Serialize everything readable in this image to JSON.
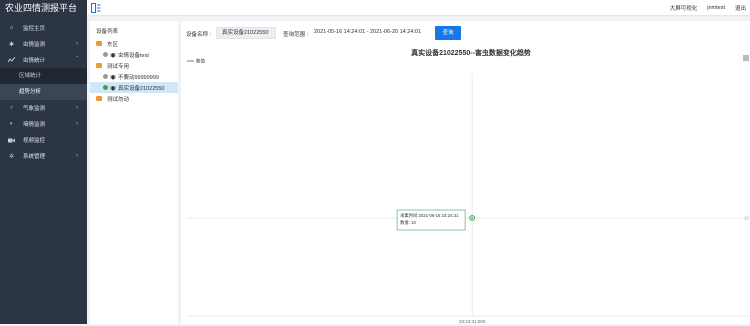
{
  "app": {
    "title": "农业四情测报平台"
  },
  "topnav": {
    "bigscreen": "大屏可视化",
    "user": "jnmtest",
    "logout": "退出"
  },
  "sidebar": {
    "items": [
      {
        "label": "监控主页",
        "icon": "home-icon",
        "expandable": false
      },
      {
        "label": "虫情监测",
        "icon": "bug-icon",
        "expandable": true
      },
      {
        "label": "虫情统计",
        "icon": "chart-icon",
        "expandable": true,
        "open": true
      }
    ],
    "subitems": [
      {
        "label": "区域统计",
        "active": false
      },
      {
        "label": "趋势分析",
        "active": true
      }
    ],
    "items2": [
      {
        "label": "气象监测",
        "icon": "weather-icon",
        "expandable": true
      },
      {
        "label": "墒情监测",
        "icon": "soil-icon",
        "expandable": true
      },
      {
        "label": "视频监控",
        "icon": "video-icon",
        "expandable": false
      },
      {
        "label": "系统管理",
        "icon": "gear-icon",
        "expandable": true
      }
    ]
  },
  "tree": {
    "title": "设备列表",
    "nodes": [
      {
        "label": "东区",
        "type": "folder",
        "level": 0
      },
      {
        "label": "虫情设备test",
        "type": "device",
        "level": 1,
        "status": "grey"
      },
      {
        "label": "测试专用",
        "type": "folder",
        "level": 0
      },
      {
        "label": "不要动99999999",
        "type": "device",
        "level": 1,
        "status": "grey"
      },
      {
        "label": "真实设备21022550",
        "type": "device",
        "level": 1,
        "status": "green",
        "selected": true
      },
      {
        "label": "测试勿动",
        "type": "folder",
        "level": 0
      }
    ]
  },
  "filter": {
    "device_label": "设备名称 :",
    "device_value": "真实设备21022550",
    "range_label": "查询范围 :",
    "range_value": "2021-05-16 14:24:01 - 2021-06-20 14:24:01",
    "search_button": "查询"
  },
  "chart_data": {
    "type": "line",
    "title": "真实设备21022550--害虫数据变化趋势",
    "legend": [
      "数值"
    ],
    "legend_position": "top-left",
    "x": [
      "23:24:31:000"
    ],
    "series": [
      {
        "name": "数值",
        "values": [
          10
        ]
      }
    ],
    "tooltip": {
      "time_label": "采集时间:2021-06-18 23:24:31",
      "value_label": "数值: 10"
    },
    "y_tick_label": "10",
    "x_tick_label": "23:24:31:000",
    "colors": {
      "line": "#3da24a",
      "accent": "#1677e8"
    }
  }
}
